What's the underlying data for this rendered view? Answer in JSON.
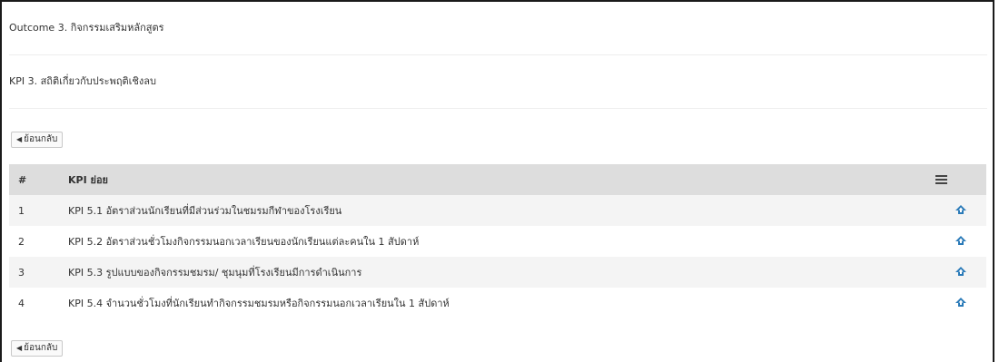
{
  "outcome": {
    "text": "Outcome 3. กิจกรรมเสริมหลักสูตร"
  },
  "kpi": {
    "text": "KPI 3. สถิติเกี่ยวกับประพฤติเชิงลบ"
  },
  "back_button": {
    "label": "ย้อนกลับ",
    "icon": "caret-left-icon"
  },
  "table": {
    "headers": {
      "num": "#",
      "name": "KPI ย่อย",
      "action_icon": "menu-icon"
    },
    "rows": [
      {
        "num": "1",
        "name": "KPI 5.1 อัตราส่วนนักเรียนที่มีส่วนร่วมในชมรมกีฬาของโรงเรียน",
        "action_icon": "cloud-upload-icon"
      },
      {
        "num": "2",
        "name": "KPI 5.2 อัตราส่วนชั่วโมงกิจกรรมนอกเวลาเรียนของนักเรียนแต่ละคนใน 1 สัปดาห์",
        "action_icon": "cloud-upload-icon"
      },
      {
        "num": "3",
        "name": "KPI 5.3 รูปแบบของกิจกรรมชมรม/ ชุมนุมที่โรงเรียนมีการดำเนินการ",
        "action_icon": "cloud-upload-icon"
      },
      {
        "num": "4",
        "name": "KPI 5.4 จำนวนชั่วโมงที่นักเรียนทำกิจกรรมชมรมหรือกิจกรรมนอกเวลาเรียนใน 1 สัปดาห์",
        "action_icon": "cloud-upload-icon"
      }
    ]
  },
  "colors": {
    "header_bg": "#dddddd",
    "stripe_bg": "#f4f4f4",
    "icon_blue": "#2a7ab8"
  }
}
